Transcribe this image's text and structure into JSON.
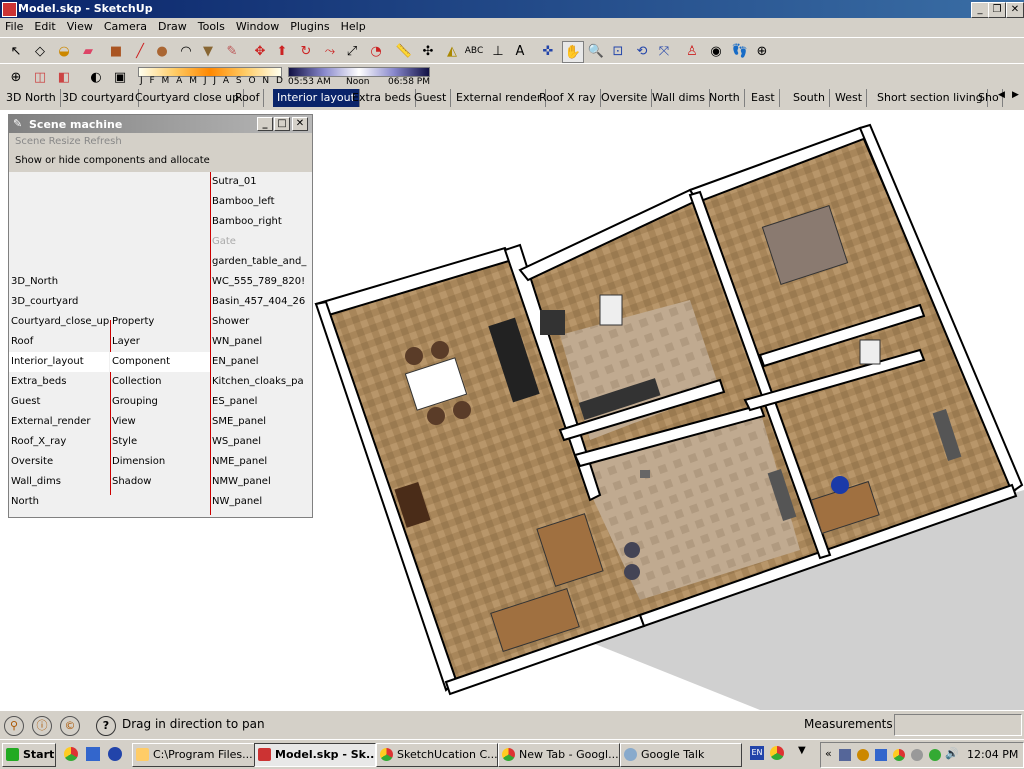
{
  "window": {
    "title": "Model.skp - SketchUp"
  },
  "menu": [
    "File",
    "Edit",
    "View",
    "Camera",
    "Draw",
    "Tools",
    "Window",
    "Plugins",
    "Help"
  ],
  "shadow_bar": {
    "months": "J F M A M J J A S O N D",
    "time_start": "05:53 AM",
    "time_mid": "Noon",
    "time_end": "06:58 PM"
  },
  "scenes": [
    "3D North",
    "3D courtyard",
    "Courtyard close up",
    "Roof",
    "Interior layout",
    "Extra beds",
    "Guest",
    "External render",
    "Roof X ray",
    "Oversite",
    "Wall dims",
    "North",
    "East",
    "South",
    "West",
    "Short section living",
    "Sho"
  ],
  "scene_selected": "Interior layout",
  "panel": {
    "title": "Scene machine",
    "menu": "Scene Resize Refresh",
    "subtitle": "Show or hide components and allocate",
    "col1": [
      "3D_North",
      "3D_courtyard",
      "Courtyard_close_up",
      "Roof",
      "Interior_layout",
      "Extra_beds",
      "Guest",
      "External_render",
      "Roof_X_ray",
      "Oversite",
      "Wall_dims",
      "North"
    ],
    "col1_selected": "Interior_layout",
    "col2": [
      "Property",
      "Layer",
      "Component",
      "Collection",
      "Grouping",
      "View",
      "Style",
      "Dimension",
      "Shadow"
    ],
    "col2_selected": "Component",
    "col3": [
      "Sutra_01",
      "Bamboo_left",
      "Bamboo_right",
      "Gate",
      "garden_table_and_",
      "WC_555_789_820!",
      "Basin_457_404_26",
      "Shower",
      "WN_panel",
      "EN_panel",
      "Kitchen_cloaks_pa",
      "ES_panel",
      "SME_panel",
      "WS_panel",
      "NME_panel",
      "NMW_panel",
      "NW_panel"
    ]
  },
  "status": {
    "hint": "Drag in direction to pan",
    "measurements_label": "Measurements"
  },
  "taskbar": {
    "start": "Start",
    "tasks": [
      "C:\\Program Files...",
      "Model.skp - Sk...",
      "SketchUcation C...",
      "New Tab - Googl...",
      "Google Talk"
    ],
    "active_task": "Model.skp - Sk...",
    "lang": "EN",
    "clock": "12:04 PM"
  },
  "colors": {
    "titlebar": "#0a246a",
    "floor": "#a8865a",
    "wall": "#ffffff",
    "selected_tab": "#0a246a"
  }
}
